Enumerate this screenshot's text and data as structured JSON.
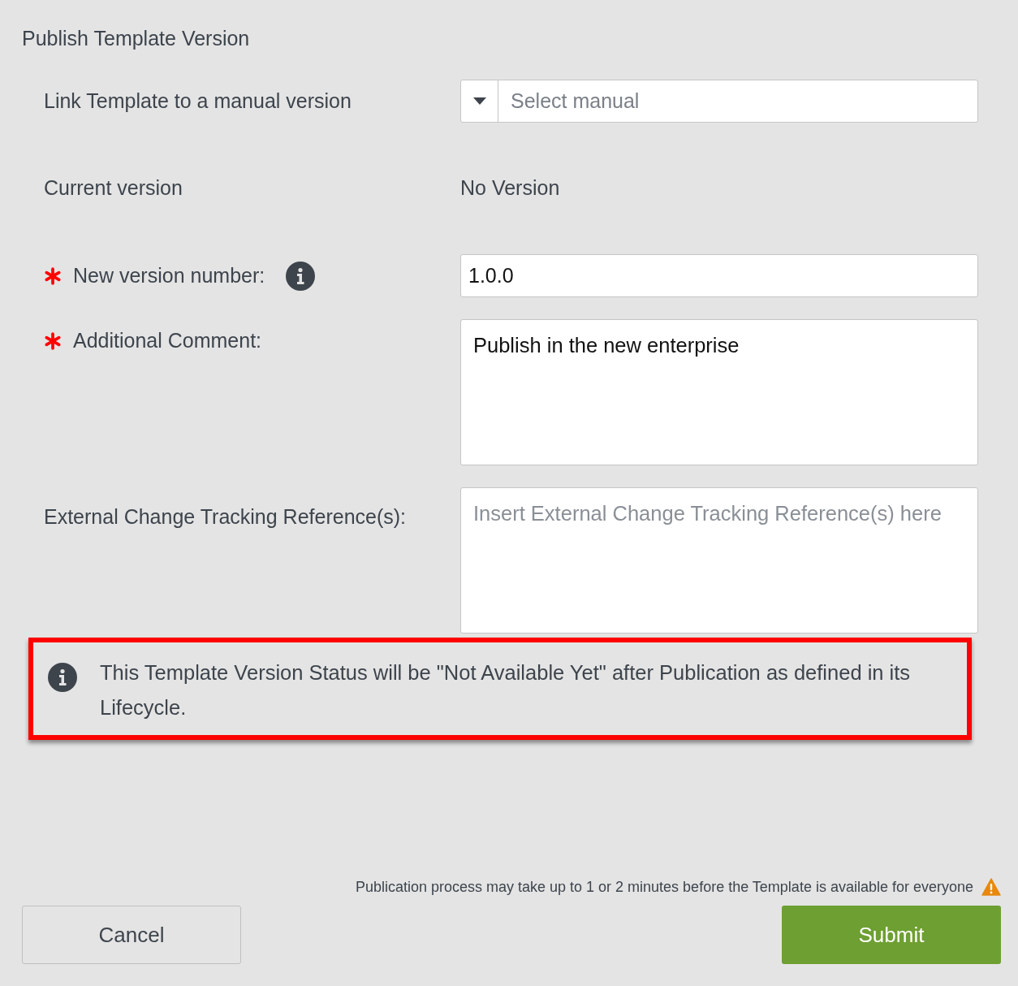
{
  "dialog": {
    "title": "Publish Template Version"
  },
  "fields": [
    {
      "kind": "select",
      "label": "Link Template to a manual version",
      "required": false,
      "info": false,
      "placeholder": "Select manual"
    },
    {
      "kind": "text",
      "label": "Current version",
      "required": false,
      "info": false,
      "value": "No Version"
    },
    {
      "kind": "input",
      "label": "New version number:",
      "required": true,
      "info": true,
      "value": "1.0.0"
    },
    {
      "kind": "textarea",
      "label": "Additional Comment:",
      "required": true,
      "info": false,
      "value": "Publish in the new enterprise"
    },
    {
      "kind": "textarea",
      "label": "External Change Tracking Reference(s):",
      "required": false,
      "info": false,
      "placeholder": "Insert External Change Tracking Reference(s) here"
    }
  ],
  "notice": {
    "text": "This Template Version Status will be \"Not Available Yet\" after Publication as defined in its Lifecycle.",
    "highlighted": true
  },
  "footer": {
    "warning": "Publication process may take up to 1 or 2 minutes before the Template is available for everyone",
    "buttons": [
      {
        "label": "Cancel",
        "kind": "secondary"
      },
      {
        "label": "Submit",
        "kind": "primary"
      }
    ]
  }
}
